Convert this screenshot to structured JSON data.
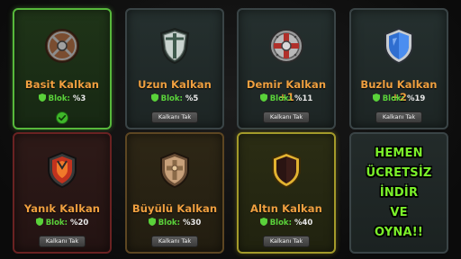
{
  "colors": {
    "name_text": "#f0a040",
    "stat_label": "#5ad23a",
    "promo_text": "#7bf02a",
    "equipped_border": "#57b83b"
  },
  "cards": [
    {
      "name": "Basit Kalkan",
      "stat_label": "Blok:",
      "stat_value": "%3",
      "equipped": true,
      "icon": "round-wooden-shield-icon"
    },
    {
      "name": "Uzun Kalkan",
      "stat_label": "Blok:",
      "stat_value": "%5",
      "button": "Kalkanı Tak",
      "icon": "long-kite-shield-icon"
    },
    {
      "name": "Demir Kalkan +1",
      "stat_label": "Blok:",
      "stat_value": "%11",
      "button": "Kalkanı Tak",
      "icon": "iron-round-shield-icon"
    },
    {
      "name": "Buzlu Kalkan +2",
      "stat_label": "Blok:",
      "stat_value": "%19",
      "button": "Kalkanı Tak",
      "icon": "ice-shield-icon"
    },
    {
      "name": "Yanık Kalkan",
      "stat_label": "Blok:",
      "stat_value": "%20",
      "button": "Kalkanı Tak",
      "icon": "burnt-shield-icon"
    },
    {
      "name": "Büyülü Kalkan",
      "stat_label": "Blok:",
      "stat_value": "%30",
      "button": "Kalkanı Tak",
      "icon": "magic-shield-icon"
    },
    {
      "name": "Altın Kalkan",
      "stat_label": "Blok:",
      "stat_value": "%40",
      "button": "Kalkanı Tak",
      "icon": "golden-shield-icon"
    }
  ],
  "promo": {
    "lines": [
      "HEMEN",
      "ÜCRETSİZ",
      "İNDİR",
      "VE",
      "OYNA!!"
    ]
  }
}
